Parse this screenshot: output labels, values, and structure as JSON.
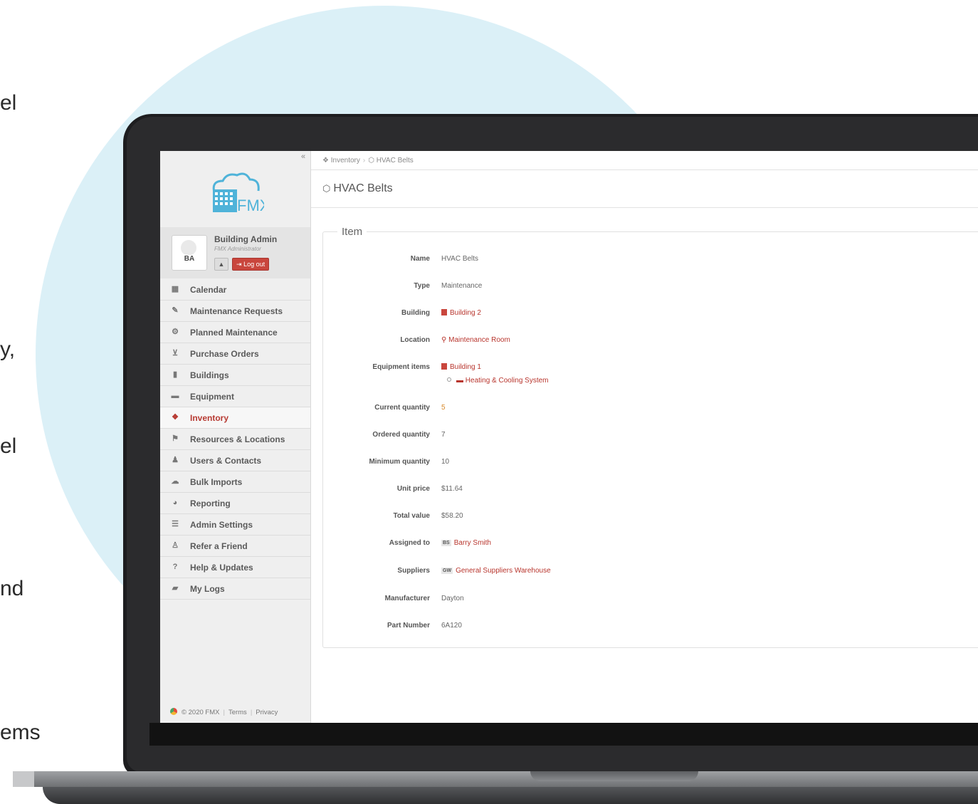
{
  "background_text": [
    "el",
    "y,",
    "el",
    "nd",
    "ems"
  ],
  "app": {
    "collapse_glyph": "«",
    "logo_text": "FMX",
    "user": {
      "name": "Building Admin",
      "role": "FMX Administrator",
      "initials": "BA",
      "logout_label": "Log out"
    },
    "nav": [
      {
        "label": "Calendar",
        "icon": "calendar-icon",
        "glyph": "▦"
      },
      {
        "label": "Maintenance Requests",
        "icon": "wrench-icon",
        "glyph": "✎"
      },
      {
        "label": "Planned Maintenance",
        "icon": "gears-icon",
        "glyph": "⚙"
      },
      {
        "label": "Purchase Orders",
        "icon": "cart-icon",
        "glyph": "⊻"
      },
      {
        "label": "Buildings",
        "icon": "building-icon",
        "glyph": "▮"
      },
      {
        "label": "Equipment",
        "icon": "briefcase-icon",
        "glyph": "▬"
      },
      {
        "label": "Inventory",
        "icon": "cubes-icon",
        "glyph": "❖",
        "active": true
      },
      {
        "label": "Resources & Locations",
        "icon": "flag-icon",
        "glyph": "⚑"
      },
      {
        "label": "Users & Contacts",
        "icon": "users-icon",
        "glyph": "♟"
      },
      {
        "label": "Bulk Imports",
        "icon": "cloud-upload-icon",
        "glyph": "☁"
      },
      {
        "label": "Reporting",
        "icon": "pie-chart-icon",
        "glyph": "◕"
      },
      {
        "label": "Admin Settings",
        "icon": "sliders-icon",
        "glyph": "☰"
      },
      {
        "label": "Refer a Friend",
        "icon": "user-plus-icon",
        "glyph": "♙"
      },
      {
        "label": "Help & Updates",
        "icon": "question-icon",
        "glyph": "?"
      },
      {
        "label": "My Logs",
        "icon": "book-icon",
        "glyph": "▰"
      }
    ],
    "footer": {
      "copyright": "© 2020 FMX",
      "terms": "Terms",
      "privacy": "Privacy"
    }
  },
  "breadcrumb": {
    "root": "Inventory",
    "current": "HVAC Belts"
  },
  "page_title": "HVAC Belts",
  "item": {
    "legend": "Item",
    "fields": {
      "name": {
        "label": "Name",
        "value": "HVAC Belts"
      },
      "type": {
        "label": "Type",
        "value": "Maintenance"
      },
      "building": {
        "label": "Building",
        "value": "Building 2"
      },
      "location": {
        "label": "Location",
        "value": "Maintenance Room"
      },
      "equipment": {
        "label": "Equipment items",
        "building": "Building 1",
        "system": "Heating & Cooling System"
      },
      "current_qty": {
        "label": "Current quantity",
        "value": "5"
      },
      "ordered_qty": {
        "label": "Ordered quantity",
        "value": "7"
      },
      "min_qty": {
        "label": "Minimum quantity",
        "value": "10"
      },
      "unit_price": {
        "label": "Unit price",
        "value": "$11.64"
      },
      "total_value": {
        "label": "Total value",
        "value": "$58.20"
      },
      "assigned": {
        "label": "Assigned to",
        "initials": "BS",
        "value": "Barry Smith"
      },
      "suppliers": {
        "label": "Suppliers",
        "initials": "GW",
        "value": "General Suppliers Warehouse"
      },
      "manufacturer": {
        "label": "Manufacturer",
        "value": "Dayton"
      },
      "part_number": {
        "label": "Part Number",
        "value": "6A120"
      }
    }
  },
  "colors": {
    "accent": "#b8352d",
    "quantity": "#d8892a",
    "circle": "#dbf0f7"
  }
}
